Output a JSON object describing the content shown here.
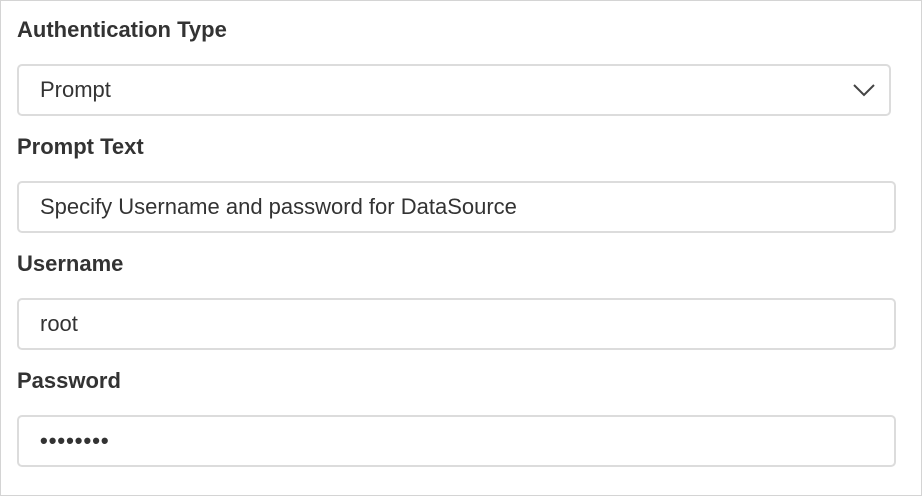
{
  "form": {
    "auth_type": {
      "label": "Authentication Type",
      "selected": "Prompt"
    },
    "prompt_text": {
      "label": "Prompt Text",
      "value": "Specify Username and password for DataSource"
    },
    "username": {
      "label": "Username",
      "value": "root"
    },
    "password": {
      "label": "Password",
      "masked_value": "••••••••"
    }
  },
  "icons": {
    "dropdown": "chevron-down-icon"
  },
  "colors": {
    "text": "#333333",
    "border": "#dcdcdc",
    "panel_border": "#d4d4d4",
    "background": "#ffffff"
  }
}
